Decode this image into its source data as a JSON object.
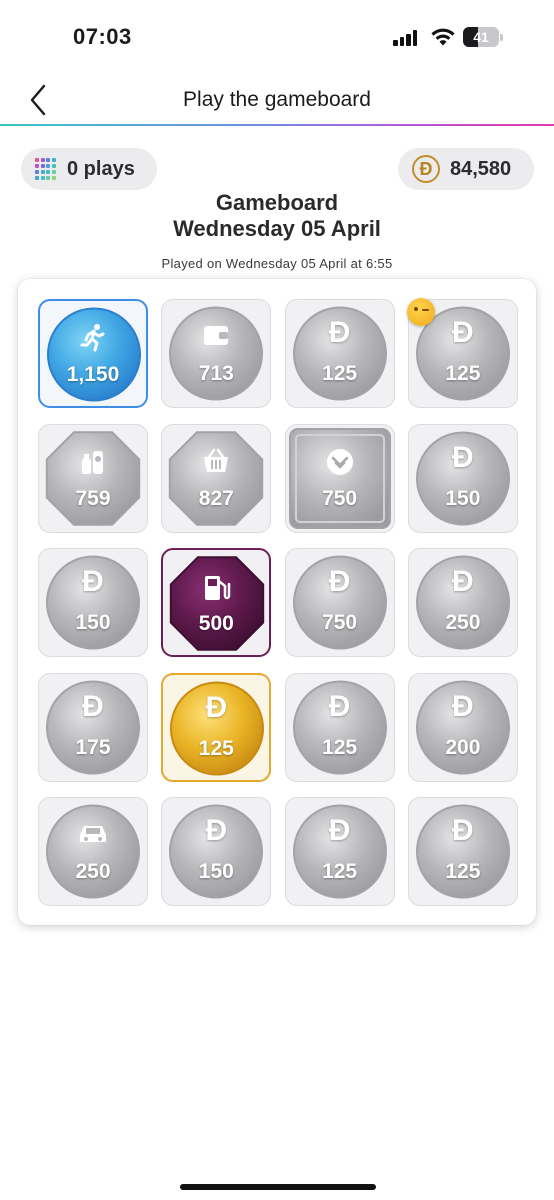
{
  "status_bar": {
    "time": "07:03",
    "battery": "41",
    "battery_level": 0.41
  },
  "nav": {
    "title": "Play the gameboard",
    "back_icon": "chevron-left-icon"
  },
  "plays": {
    "label": "0 plays",
    "icon": "grid-icon"
  },
  "points": {
    "label": "84,580",
    "icon": "dirham-icon",
    "symbol": "Đ"
  },
  "heading": {
    "line1": "Gameboard",
    "line2": "Wednesday 05 April"
  },
  "played_on": "Played on Wednesday 05 April at 6:55",
  "colors": {
    "accent_gradient": [
      "#39c6c6",
      "#6f8fe0",
      "#b955d6",
      "#e23aa8"
    ],
    "gold": "#e5a72c",
    "purple": "#6b1e57",
    "blue": "#3d8ee6"
  },
  "board": {
    "tiles": [
      {
        "value": "1,150",
        "icon": "runner-icon",
        "shape": "coin",
        "style": "blue"
      },
      {
        "value": "713",
        "icon": "wallet-icon",
        "shape": "coin",
        "style": "silver"
      },
      {
        "value": "125",
        "icon": "dirham-icon",
        "shape": "coin",
        "style": "silver"
      },
      {
        "value": "125",
        "icon": "dirham-icon",
        "shape": "coin",
        "style": "silver",
        "badge": "emoji-icon"
      },
      {
        "value": "759",
        "icon": "cosmetics-icon",
        "shape": "octagon",
        "style": "silver"
      },
      {
        "value": "827",
        "icon": "basket-icon",
        "shape": "octagon",
        "style": "silver"
      },
      {
        "value": "750",
        "icon": "logo-icon",
        "shape": "square",
        "style": "silver"
      },
      {
        "value": "150",
        "icon": "dirham-icon",
        "shape": "coin",
        "style": "silver"
      },
      {
        "value": "150",
        "icon": "dirham-icon",
        "shape": "coin",
        "style": "silver"
      },
      {
        "value": "500",
        "icon": "fuel-pump-icon",
        "shape": "octagon",
        "style": "purple"
      },
      {
        "value": "750",
        "icon": "dirham-icon",
        "shape": "coin",
        "style": "silver"
      },
      {
        "value": "250",
        "icon": "dirham-icon",
        "shape": "coin",
        "style": "silver"
      },
      {
        "value": "175",
        "icon": "dirham-icon",
        "shape": "coin",
        "style": "silver"
      },
      {
        "value": "125",
        "icon": "dirham-icon",
        "shape": "coin",
        "style": "gold"
      },
      {
        "value": "125",
        "icon": "dirham-icon",
        "shape": "coin",
        "style": "silver"
      },
      {
        "value": "200",
        "icon": "dirham-icon",
        "shape": "coin",
        "style": "silver"
      },
      {
        "value": "250",
        "icon": "car-icon",
        "shape": "coin",
        "style": "silver"
      },
      {
        "value": "150",
        "icon": "dirham-icon",
        "shape": "coin",
        "style": "silver"
      },
      {
        "value": "125",
        "icon": "dirham-icon",
        "shape": "coin",
        "style": "silver"
      },
      {
        "value": "125",
        "icon": "dirham-icon",
        "shape": "coin",
        "style": "silver"
      }
    ]
  }
}
